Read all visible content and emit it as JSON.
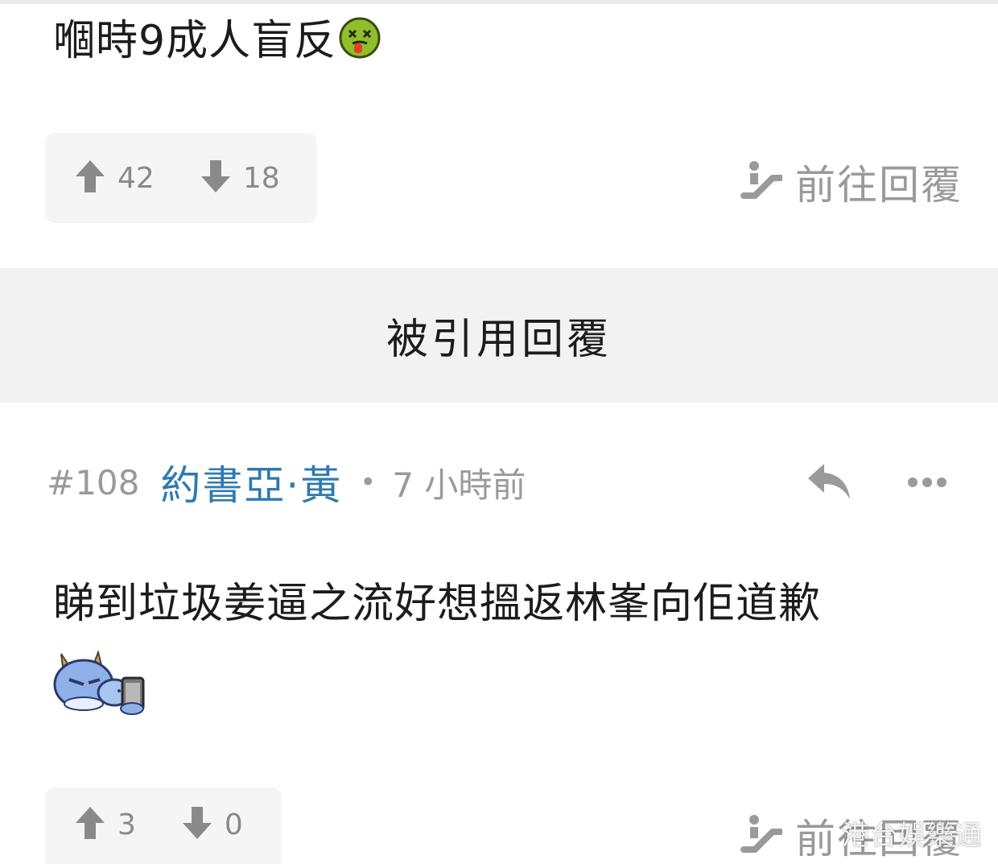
{
  "prev_post": {
    "body": "嗰時9成人盲反",
    "emoji": "dizzy-sick-face-emoji",
    "upvotes": "42",
    "downvotes": "18",
    "goto_reply_label": "前往回覆"
  },
  "quoted_section": {
    "label": "被引用回覆"
  },
  "post": {
    "number": "#108",
    "author": "約書亞·黃",
    "separator": "•",
    "time": "7 小時前",
    "body": "睇到垃圾姜逼之流好想搵返林峯向佢道歉",
    "sticker": "dragon-phone-sticker",
    "upvotes": "3",
    "downvotes": "0",
    "goto_reply_label": "前往回覆"
  },
  "watermark": "港台娛樂通",
  "colors": {
    "author": "#2f7ab0",
    "meta_gray": "#9a9a9a",
    "vote_bg": "#f5f5f5",
    "quoted_bg": "#f2f2f2"
  }
}
